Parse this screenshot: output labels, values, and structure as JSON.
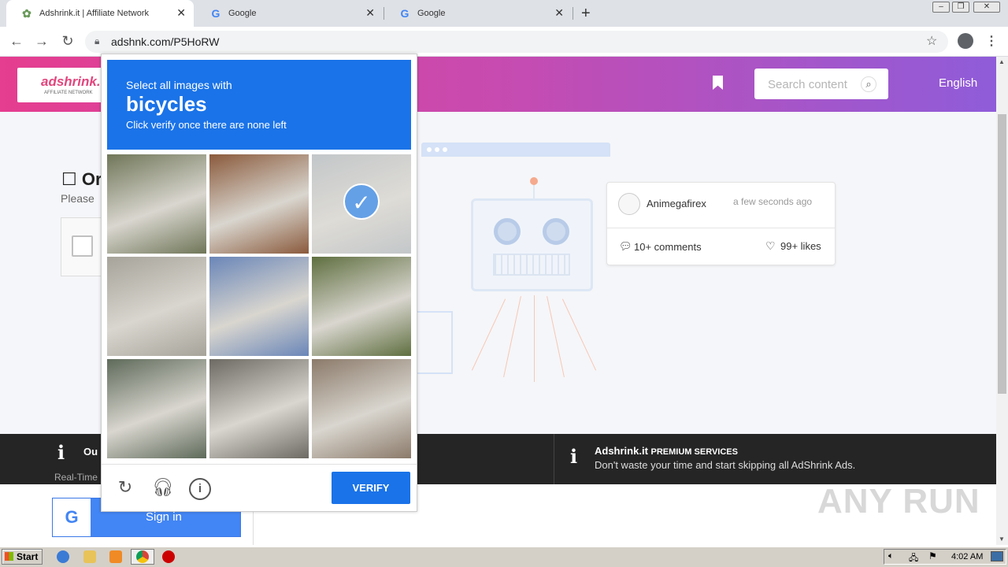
{
  "browser": {
    "tabs": [
      {
        "title": "Adshrink.it | Affiliate Network",
        "active": true
      },
      {
        "title": "Google",
        "active": false
      },
      {
        "title": "Google",
        "active": false
      }
    ],
    "url": "adshnk.com/P5HoRW"
  },
  "site": {
    "logo_text": "adshrink.it",
    "logo_sub": "AFFILIATE NETWORK",
    "search_placeholder": "Search content",
    "language": "English",
    "check_title": "Or",
    "please_text": "Please"
  },
  "card": {
    "user": "Animegafirex",
    "time": "a few seconds ago",
    "comments": "10+ comments",
    "likes": "99+ likes"
  },
  "footer": {
    "left_title": "Ou",
    "left_sub": "Real-Time",
    "right_title_brand": "Adshrink.it",
    "right_title_rest": "PREMIUM SERVICES",
    "right_sub": "Don't waste your time and start skipping all AdShrink Ads."
  },
  "signin": {
    "label": "Sign in",
    "g": "G"
  },
  "captcha": {
    "line1": "Select all images with",
    "target": "bicycles",
    "line3": "Click verify once there are none left",
    "verify_label": "VERIFY",
    "tiles": [
      {
        "scene": "bus on tree-lined street",
        "selected": false,
        "color": "#6f7658"
      },
      {
        "scene": "brick archway",
        "selected": false,
        "color": "#8a5a3c"
      },
      {
        "scene": "parked bicycles",
        "selected": true,
        "color": "#b9bdc0"
      },
      {
        "scene": "street crossing with cars",
        "selected": false,
        "color": "#a6a39a"
      },
      {
        "scene": "tree lined road",
        "selected": false,
        "color": "#6a86b8"
      },
      {
        "scene": "child on bicycle",
        "selected": false,
        "color": "#5f6f40"
      },
      {
        "scene": "market stalls",
        "selected": false,
        "color": "#5e6a5a"
      },
      {
        "scene": "parked car by shop",
        "selected": false,
        "color": "#6c6a62"
      },
      {
        "scene": "shop front",
        "selected": false,
        "color": "#8b7a6a"
      }
    ]
  },
  "taskbar": {
    "start": "Start",
    "clock": "4:02 AM"
  },
  "watermark": "ANY RUN"
}
